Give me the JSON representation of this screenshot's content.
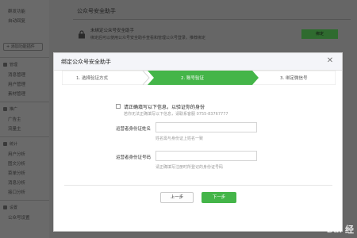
{
  "background": {
    "sidebar": {
      "items_top": [
        "群发功能",
        "自动回复"
      ],
      "add_button": "+ 添加功能插件",
      "group_manage": "管理",
      "manage_items": [
        "消息管理",
        "用户管理",
        "素材管理"
      ],
      "group_promote": "推广",
      "promote_items": [
        "广告主",
        "流量主"
      ],
      "group_stats": "统计",
      "stats_items": [
        "用户分析",
        "图文分析",
        "菜单分析",
        "消息分析",
        "接口分析"
      ],
      "group_settings": "设置",
      "settings_items": [
        "公众号设置"
      ]
    },
    "main": {
      "title": "公众号安全助手",
      "info_line1": "未绑定公众号安全助手",
      "info_line2": "绑定后可以使用公众号安全助手查看和管理公众号登录，推荐绑定",
      "bind_button": "绑定"
    }
  },
  "modal": {
    "title": "绑定公众号安全助手",
    "close_icon": "close-icon",
    "steps": [
      {
        "label": "1. 选择验证方式",
        "state": "done"
      },
      {
        "label": "2. 账号验证",
        "state": "active"
      },
      {
        "label": "3. 绑定微信号",
        "state": "todo"
      }
    ],
    "notice_title": "请正确填写以下信息，以验证你的身份",
    "notice_sub": "若你无法正确填写以下信息，请联系客服 0755-83767777",
    "fields": [
      {
        "label": "运营者身份证姓名",
        "value": "",
        "hint": "姓名需与身份证上姓名一致"
      },
      {
        "label": "运营者身份证号码",
        "value": "",
        "hint": "请正确填写注册时所登记的身份证号码"
      }
    ],
    "prev_button": "上一步",
    "next_button": "下一步"
  },
  "watermark": "Bai 经",
  "colors": {
    "accent": "#44b549",
    "step_done": "#ffffff",
    "step_todo": "#ffffff"
  }
}
